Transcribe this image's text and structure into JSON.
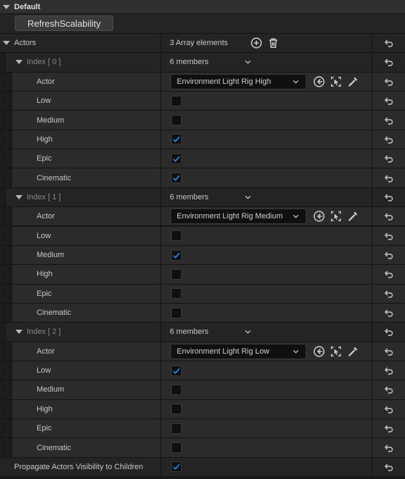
{
  "header": {
    "title": "Default"
  },
  "refresh_button": "RefreshScalability",
  "actors": {
    "label": "Actors",
    "count_text": "3 Array elements",
    "items": [
      {
        "index_label": "Index [ 0 ]",
        "members_text": "6 members",
        "actor_label": "Actor",
        "actor_value": "Environment Light Rig High",
        "flags": [
          {
            "label": "Low",
            "checked": false
          },
          {
            "label": "Medium",
            "checked": false
          },
          {
            "label": "High",
            "checked": true
          },
          {
            "label": "Epic",
            "checked": true
          },
          {
            "label": "Cinematic",
            "checked": true
          }
        ]
      },
      {
        "index_label": "Index [ 1 ]",
        "members_text": "6 members",
        "actor_label": "Actor",
        "actor_value": "Environment Light Rig Medium",
        "flags": [
          {
            "label": "Low",
            "checked": false
          },
          {
            "label": "Medium",
            "checked": true
          },
          {
            "label": "High",
            "checked": false
          },
          {
            "label": "Epic",
            "checked": false
          },
          {
            "label": "Cinematic",
            "checked": false
          }
        ]
      },
      {
        "index_label": "Index [ 2 ]",
        "members_text": "6 members",
        "actor_label": "Actor",
        "actor_value": "Environment Light Rig Low",
        "flags": [
          {
            "label": "Low",
            "checked": true
          },
          {
            "label": "Medium",
            "checked": false
          },
          {
            "label": "High",
            "checked": false
          },
          {
            "label": "Epic",
            "checked": false
          },
          {
            "label": "Cinematic",
            "checked": false
          }
        ]
      }
    ]
  },
  "propagate": {
    "label": "Propagate Actors Visibility to Children",
    "checked": true
  },
  "colors": {
    "check_accent": "#2f7fd6",
    "background": "#242424",
    "checkbox_bg": "#0f0f0f"
  },
  "icons": {
    "reset": "reset-arrow-icon",
    "add": "add-element-icon",
    "delete": "trash-icon",
    "browse": "use-selected-icon",
    "select": "select-in-level-icon",
    "pick": "eyedropper-icon"
  }
}
